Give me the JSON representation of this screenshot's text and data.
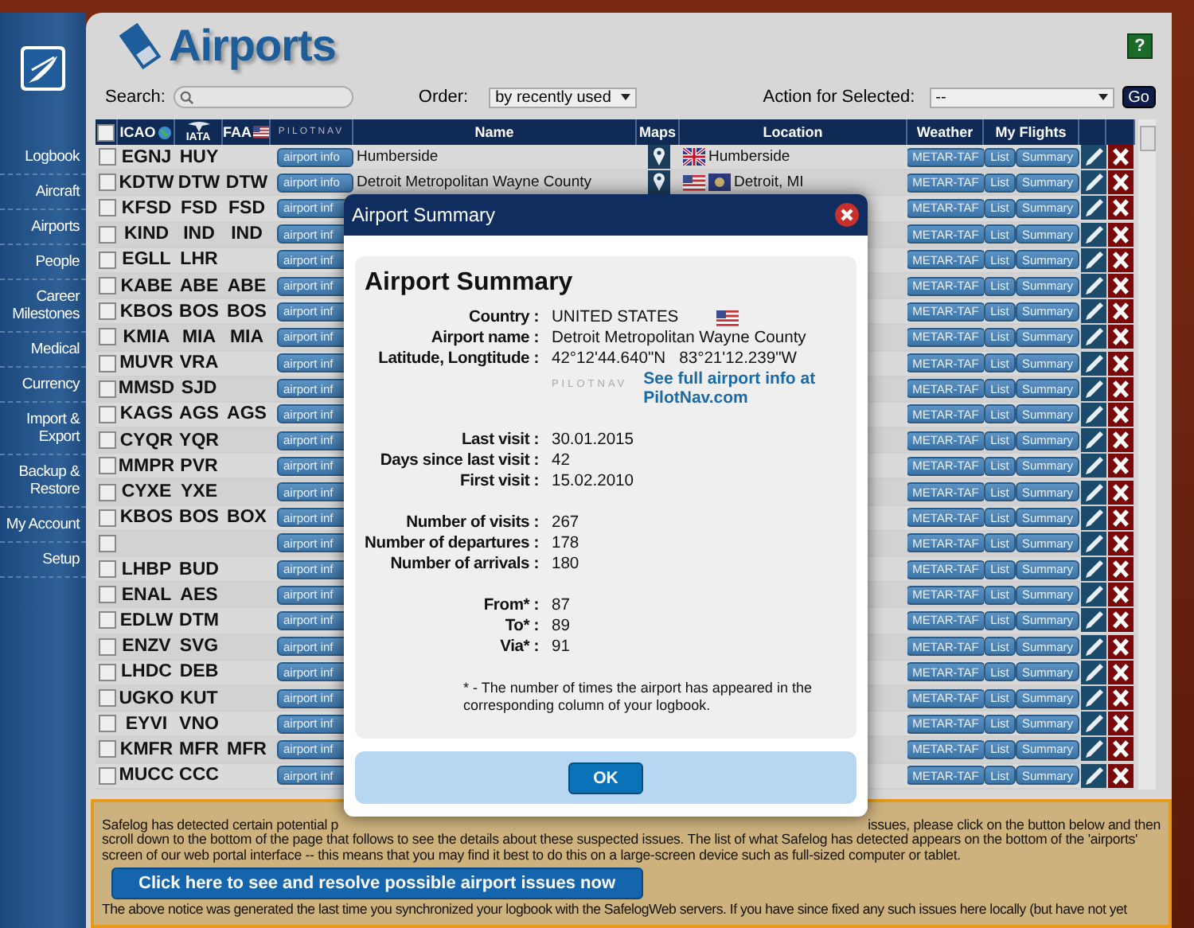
{
  "sidebar": {
    "items": [
      {
        "label": "Logbook"
      },
      {
        "label": "Aircraft"
      },
      {
        "label": "Airports"
      },
      {
        "label": "People"
      },
      {
        "label": "Career Milestones"
      },
      {
        "label": "Medical"
      },
      {
        "label": "Currency"
      },
      {
        "label": "Import & Export"
      },
      {
        "label": "Backup & Restore"
      },
      {
        "label": "My Account"
      },
      {
        "label": "Setup"
      }
    ]
  },
  "header": {
    "title": "Airports",
    "help": "?"
  },
  "toolbar": {
    "search_label": "Search:",
    "order_label": "Order:",
    "order_value": "by recently used",
    "action_label": "Action for Selected:",
    "action_value": "--",
    "go": "Go"
  },
  "table": {
    "select_all_checked": false,
    "columns": [
      {
        "label": "ICAO"
      },
      {
        "label": "IATA"
      },
      {
        "label": "FAA"
      },
      {
        "label": "PILOTNAV"
      },
      {
        "label": "Name"
      },
      {
        "label": "Maps"
      },
      {
        "label": "Location"
      },
      {
        "label": "Weather"
      },
      {
        "label": "My Flights"
      }
    ],
    "rows": [
      {
        "checked": false,
        "icao": "EGNJ",
        "iata": "HUY",
        "faa": "",
        "info": "airport info",
        "name": "Humberside",
        "location": "Humberside",
        "kind": "uk",
        "weather": "METAR-TAF",
        "list": "List",
        "summary": "Summary"
      },
      {
        "checked": false,
        "icao": "KDTW",
        "iata": "DTW",
        "faa": "DTW",
        "info": "airport info",
        "name": "Detroit Metropolitan Wayne County",
        "location": "Detroit, MI",
        "kind": "us-state",
        "weather": "METAR-TAF",
        "list": "List",
        "summary": "Summary"
      },
      {
        "checked": false,
        "icao": "KFSD",
        "iata": "FSD",
        "faa": "FSD",
        "info": "airport inf",
        "weather": "METAR-TAF",
        "list": "List",
        "summary": "Summary"
      },
      {
        "checked": false,
        "icao": "KIND",
        "iata": "IND",
        "faa": "IND",
        "info": "airport inf",
        "weather": "METAR-TAF",
        "list": "List",
        "summary": "Summary"
      },
      {
        "checked": false,
        "icao": "EGLL",
        "iata": "LHR",
        "faa": "",
        "info": "airport inf",
        "weather": "METAR-TAF",
        "list": "List",
        "summary": "Summary"
      },
      {
        "checked": false,
        "icao": "KABE",
        "iata": "ABE",
        "faa": "ABE",
        "info": "airport inf",
        "weather": "METAR-TAF",
        "list": "List",
        "summary": "Summary"
      },
      {
        "checked": false,
        "icao": "KBOS",
        "iata": "BOS",
        "faa": "BOS",
        "info": "airport inf",
        "weather": "METAR-TAF",
        "list": "List",
        "summary": "Summary"
      },
      {
        "checked": false,
        "icao": "KMIA",
        "iata": "MIA",
        "faa": "MIA",
        "info": "airport inf",
        "weather": "METAR-TAF",
        "list": "List",
        "summary": "Summary"
      },
      {
        "checked": false,
        "icao": "MUVR",
        "iata": "VRA",
        "faa": "",
        "info": "airport inf",
        "weather": "METAR-TAF",
        "list": "List",
        "summary": "Summary"
      },
      {
        "checked": false,
        "icao": "MMSD",
        "iata": "SJD",
        "faa": "",
        "info": "airport inf",
        "weather": "METAR-TAF",
        "list": "List",
        "summary": "Summary"
      },
      {
        "checked": false,
        "icao": "KAGS",
        "iata": "AGS",
        "faa": "AGS",
        "info": "airport inf",
        "weather": "METAR-TAF",
        "list": "List",
        "summary": "Summary"
      },
      {
        "checked": false,
        "icao": "CYQR",
        "iata": "YQR",
        "faa": "",
        "info": "airport inf",
        "weather": "METAR-TAF",
        "list": "List",
        "summary": "Summary"
      },
      {
        "checked": false,
        "icao": "MMPR",
        "iata": "PVR",
        "faa": "",
        "info": "airport inf",
        "weather": "METAR-TAF",
        "list": "List",
        "summary": "Summary"
      },
      {
        "checked": false,
        "icao": "CYXE",
        "iata": "YXE",
        "faa": "",
        "info": "airport inf",
        "weather": "METAR-TAF",
        "list": "List",
        "summary": "Summary"
      },
      {
        "checked": false,
        "icao": "KBOS",
        "iata": "BOS",
        "faa": "BOX",
        "info": "airport inf",
        "weather": "METAR-TAF",
        "list": "List",
        "summary": "Summary"
      },
      {
        "checked": false,
        "icao": "",
        "iata": "",
        "faa": "",
        "info": "airport inf",
        "weather": "METAR-TAF",
        "list": "List",
        "summary": "Summary"
      },
      {
        "checked": false,
        "icao": "LHBP",
        "iata": "BUD",
        "faa": "",
        "info": "airport inf",
        "weather": "METAR-TAF",
        "list": "List",
        "summary": "Summary"
      },
      {
        "checked": false,
        "icao": "ENAL",
        "iata": "AES",
        "faa": "",
        "info": "airport inf",
        "weather": "METAR-TAF",
        "list": "List",
        "summary": "Summary"
      },
      {
        "checked": false,
        "icao": "EDLW",
        "iata": "DTM",
        "faa": "",
        "info": "airport inf",
        "weather": "METAR-TAF",
        "list": "List",
        "summary": "Summary"
      },
      {
        "checked": false,
        "icao": "ENZV",
        "iata": "SVG",
        "faa": "",
        "info": "airport inf",
        "weather": "METAR-TAF",
        "list": "List",
        "summary": "Summary"
      },
      {
        "checked": false,
        "icao": "LHDC",
        "iata": "DEB",
        "faa": "",
        "info": "airport inf",
        "weather": "METAR-TAF",
        "list": "List",
        "summary": "Summary"
      },
      {
        "checked": false,
        "icao": "UGKO",
        "iata": "KUT",
        "faa": "",
        "info": "airport inf",
        "weather": "METAR-TAF",
        "list": "List",
        "summary": "Summary"
      },
      {
        "checked": false,
        "icao": "EYVI",
        "iata": "VNO",
        "faa": "",
        "info": "airport inf",
        "weather": "METAR-TAF",
        "list": "List",
        "summary": "Summary"
      },
      {
        "checked": false,
        "icao": "KMFR",
        "iata": "MFR",
        "faa": "MFR",
        "info": "airport inf",
        "weather": "METAR-TAF",
        "list": "List",
        "summary": "Summary"
      },
      {
        "checked": false,
        "icao": "MUCC",
        "iata": "CCC",
        "faa": "",
        "info": "airport inf",
        "weather": "METAR-TAF",
        "list": "List",
        "summary": "Summary"
      }
    ]
  },
  "dialog": {
    "title": "Airport Summary",
    "heading": "Airport Summary",
    "groups": [
      [
        {
          "label": "Country :",
          "value": "UNITED STATES",
          "kind": "country"
        },
        {
          "label": "Airport name :",
          "value": "Detroit Metropolitan Wayne County",
          "kind": "text"
        },
        {
          "label": "Latitude, Longtitude :",
          "value": "42°12'44.640\"N   83°21'12.239\"W",
          "kind": "text"
        }
      ],
      [
        {
          "label": "Last visit :",
          "value": "30.01.2015",
          "kind": "text"
        },
        {
          "label": "Days since last visit :",
          "value": "42",
          "kind": "text"
        },
        {
          "label": "First visit :",
          "value": "15.02.2010",
          "kind": "text"
        }
      ],
      [
        {
          "label": "Number of visits :",
          "value": "267",
          "kind": "text"
        },
        {
          "label": "Number of departures :",
          "value": "178",
          "kind": "text"
        },
        {
          "label": "Number of arrivals :",
          "value": "180",
          "kind": "text"
        }
      ],
      [
        {
          "label": "From* :",
          "value": "87",
          "kind": "text"
        },
        {
          "label": "To* :",
          "value": "89",
          "kind": "text"
        },
        {
          "label": "Via* :",
          "value": "91",
          "kind": "text"
        }
      ]
    ],
    "pilotnav": "PILOTNAV",
    "link": "See full airport info at PilotNav.com",
    "footnote": "* - The number of times the airport has appeared in the corresponding column of your logbook.",
    "ok": "OK"
  },
  "notice": {
    "line_start": "Safelog has detected certain potential p",
    "line_end": "issues, please click on the button below and then",
    "text": "scroll down to the bottom of the page that follows to see the details about these suspected issues. The list of what Safelog has detected appears on the bottom of the 'airports' screen of our web portal interface -- this means that you may find it best to do this on a large-screen device such as full-sized computer or tablet.",
    "button": "Click here to see and resolve possible airport issues now",
    "footer": "The above notice was generated the last time you synchronized your logbook with the SafelogWeb servers. If you have since fixed any such issues here locally (but have not yet"
  }
}
